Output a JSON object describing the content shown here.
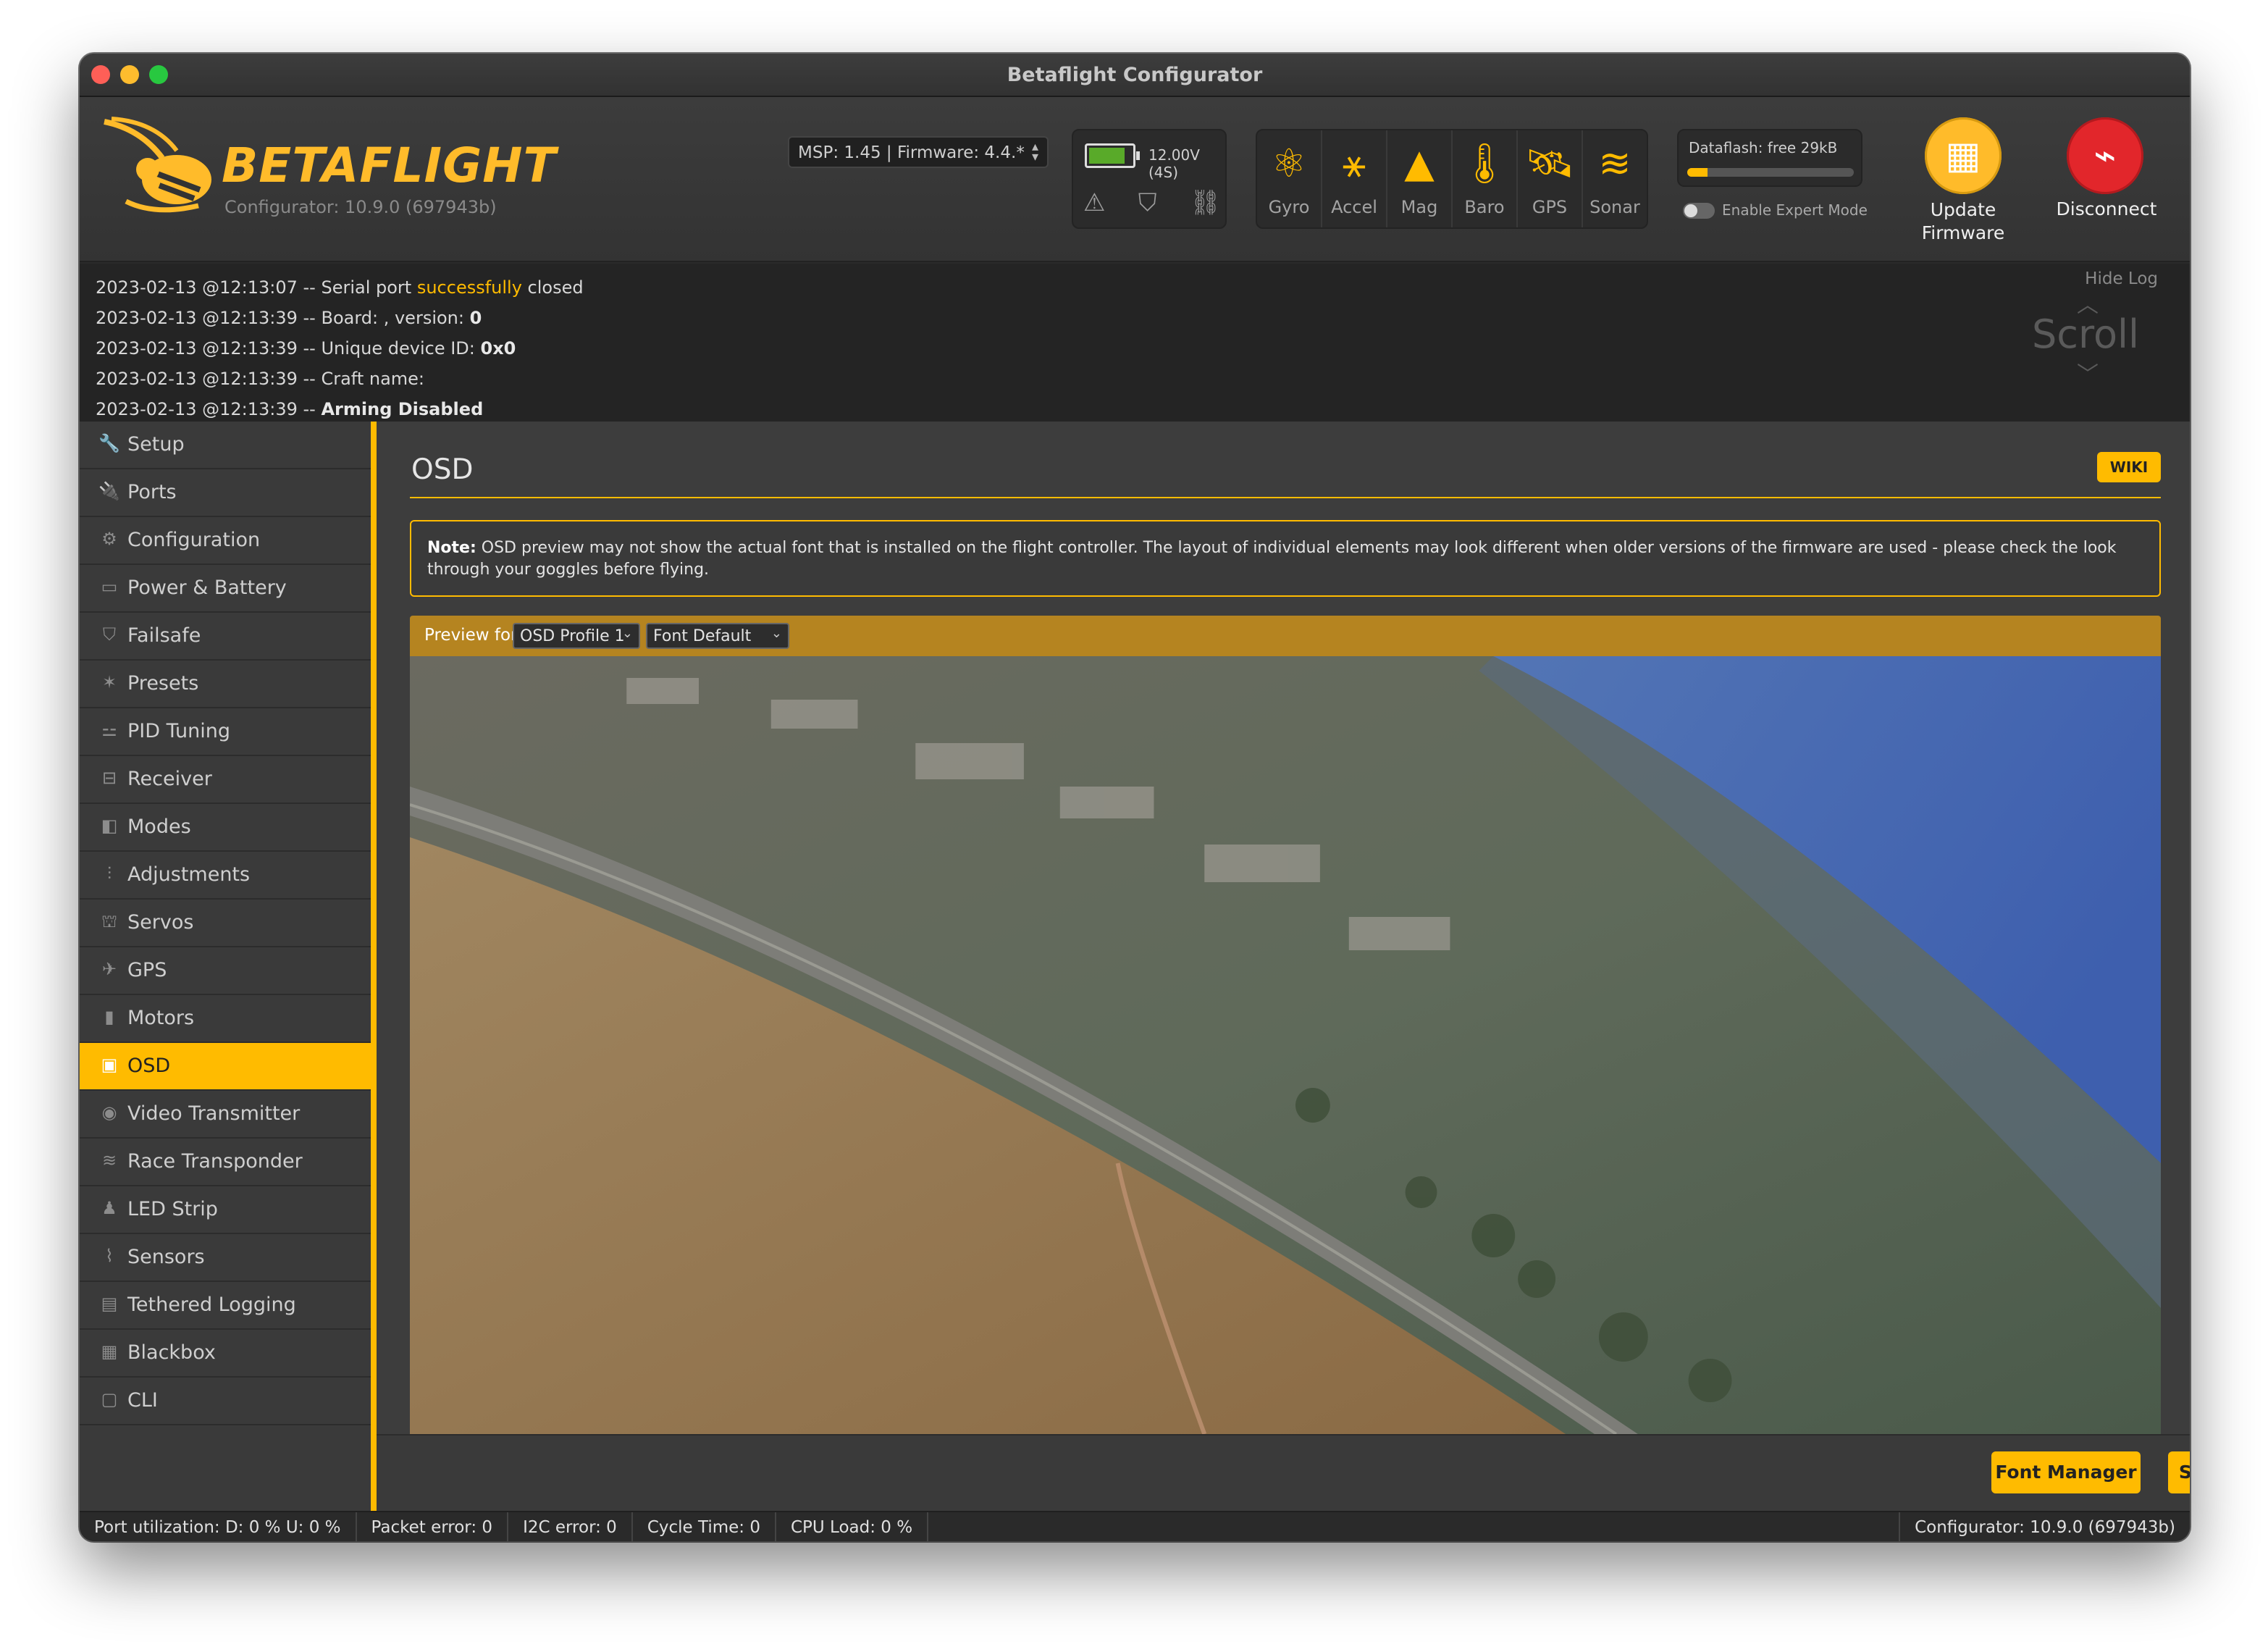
{
  "window": {
    "title": "Betaflight Configurator"
  },
  "header": {
    "logo_text": "BETAFLIGHT",
    "logo_subtitle": "Configurator: 10.9.0 (697943b)",
    "msp_firmware": "MSP: 1.45 | Firmware: 4.4.*",
    "battery": {
      "voltage": "12.00V (4S)",
      "level": 0.85,
      "icons": [
        "warning-icon",
        "parachute-icon",
        "link-icon"
      ]
    },
    "sensors": [
      {
        "label": "Gyro",
        "icon": "gyro-icon"
      },
      {
        "label": "Accel",
        "icon": "accel-icon"
      },
      {
        "label": "Mag",
        "icon": "mag-icon"
      },
      {
        "label": "Baro",
        "icon": "baro-icon"
      },
      {
        "label": "GPS",
        "icon": "gps-icon"
      },
      {
        "label": "Sonar",
        "icon": "sonar-icon"
      }
    ],
    "dataflash": {
      "label": "Dataflash: free 29kB",
      "used_fraction": 0.12
    },
    "expert_mode_label": "Enable Expert Mode",
    "update_firmware_label_1": "Update",
    "update_firmware_label_2": "Firmware",
    "disconnect_label": "Disconnect",
    "accent_color": "#ffbb00"
  },
  "log": {
    "hide_log": "Hide Log",
    "scroll": "Scroll",
    "lines": [
      {
        "prefix": "2023-02-13 @12:13:07 -- Serial port ",
        "highlight": "successfully",
        "suffix": " closed"
      },
      {
        "prefix": "2023-02-13 @12:13:39 -- Board: , version: ",
        "bold": "0"
      },
      {
        "prefix": "2023-02-13 @12:13:39 -- Unique device ID: ",
        "bold": "0x0"
      },
      {
        "prefix": "2023-02-13 @12:13:39 -- Craft name: "
      },
      {
        "prefix": "2023-02-13 @12:13:39 -- ",
        "bold": "Arming Disabled"
      }
    ]
  },
  "sidebar": {
    "items": [
      {
        "label": "Setup",
        "icon": "wrench-icon",
        "glyph": "🔧"
      },
      {
        "label": "Ports",
        "icon": "plug-icon",
        "glyph": "🔌"
      },
      {
        "label": "Configuration",
        "icon": "gear-icon",
        "glyph": "⚙"
      },
      {
        "label": "Power & Battery",
        "icon": "battery-icon",
        "glyph": "▭"
      },
      {
        "label": "Failsafe",
        "icon": "parachute-icon",
        "glyph": "⛉"
      },
      {
        "label": "Presets",
        "icon": "magic-wand-icon",
        "glyph": "✶"
      },
      {
        "label": "PID Tuning",
        "icon": "network-icon",
        "glyph": "⚍"
      },
      {
        "label": "Receiver",
        "icon": "receiver-icon",
        "glyph": "⊟"
      },
      {
        "label": "Modes",
        "icon": "toggle-icon",
        "glyph": "◧"
      },
      {
        "label": "Adjustments",
        "icon": "sliders-icon",
        "glyph": "⫶"
      },
      {
        "label": "Servos",
        "icon": "servo-icon",
        "glyph": "⛫"
      },
      {
        "label": "GPS",
        "icon": "satellite-icon",
        "glyph": "✈"
      },
      {
        "label": "Motors",
        "icon": "motor-icon",
        "glyph": "▮"
      },
      {
        "label": "OSD",
        "icon": "osd-icon",
        "glyph": "▣",
        "active": true
      },
      {
        "label": "Video Transmitter",
        "icon": "antenna-icon",
        "glyph": "◉"
      },
      {
        "label": "Race Transponder",
        "icon": "transponder-icon",
        "glyph": "≋"
      },
      {
        "label": "LED Strip",
        "icon": "led-icon",
        "glyph": "♟"
      },
      {
        "label": "Sensors",
        "icon": "pulse-icon",
        "glyph": "⌇"
      },
      {
        "label": "Tethered Logging",
        "icon": "log-icon",
        "glyph": "▤"
      },
      {
        "label": "Blackbox",
        "icon": "blackbox-icon",
        "glyph": "▦"
      },
      {
        "label": "CLI",
        "icon": "terminal-icon",
        "glyph": "▢"
      }
    ]
  },
  "main": {
    "title": "OSD",
    "wiki_label": "WIKI",
    "note_bold": "Note:",
    "note_text": " OSD preview may not show the actual font that is installed on the flight controller. The layout of individual elements may look different when older versions of the firmware are used - please check the look through your goggles before flying.",
    "preview_label": "Preview for",
    "profile_select": "OSD Profile 1",
    "font_select": "Font Default",
    "font_manager_label": "Font Manager",
    "save_label": "Save"
  },
  "statusbar": {
    "port_utilization": "Port utilization: D: 0 % U: 0 %",
    "packet_error": "Packet error: 0",
    "i2c_error": "I2C error: 0",
    "cycle_time": "Cycle Time: 0",
    "cpu_load": "CPU Load: 0 %",
    "version": "Configurator: 10.9.0 (697943b)"
  }
}
